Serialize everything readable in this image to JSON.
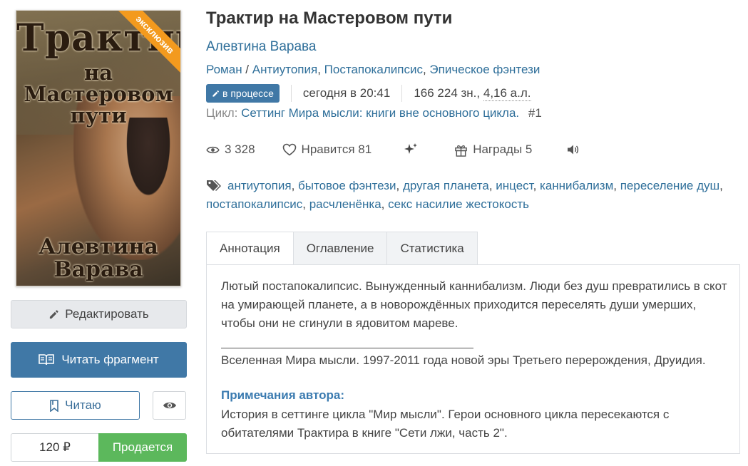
{
  "cover": {
    "title_line1": "Трактир",
    "title_line2": "на Мастеровом пути",
    "author_text": "Алевтина Варава",
    "ribbon": "эксклюзив"
  },
  "actions": {
    "edit_label": "Редактировать",
    "read_fragment_label": "Читать фрагмент",
    "reading_label": "Читаю",
    "price": "120 ₽",
    "sale_label": "Продается"
  },
  "book": {
    "title": "Трактир на Мастеровом пути",
    "author": "Алевтина Варава",
    "genres": [
      "Роман",
      "Антиутопия",
      "Постапокалипсис",
      "Эпическое фэнтези"
    ],
    "genre_sep1": " / ",
    "genre_sep2": ", ",
    "genre_sep3": ", ",
    "status_badge": "в процессе",
    "updated": "сегодня в 20:41",
    "size_chars": "166 224 зн.,",
    "size_sheets": "4,16 а.л.",
    "cycle_label": "Цикл:",
    "cycle_name": "Сеттинг Мира мысли: книги вне основного цикла.",
    "cycle_num": "#1"
  },
  "stats": {
    "views": "3 328",
    "likes_label": "Нравится 81",
    "awards_label": "Награды 5"
  },
  "tags": [
    "антиутопия",
    "бытовое фэнтези",
    "другая планета",
    "инцест",
    "каннибализм",
    "переселение душ",
    "постапокалипсис",
    "расчленёнка",
    "секс насилие жестокость"
  ],
  "tabs": [
    "Аннотация",
    "Оглавление",
    "Статистика"
  ],
  "annotation": {
    "text": "Лютый постапокалипсис. Вынужденный каннибализм. Люди без душ превратились в скот на умирающей планете, а в новорождённых приходится переселять души умерших, чтобы они не сгинули в ядовитом мареве.",
    "universe": "Вселенная Мира мысли. 1997-2011 года новой эры Третьего перерождения, Друидия.",
    "notes_heading": "Примечания автора:",
    "notes": "История в сеттинге цикла \"Мир мысли\". Герои основного цикла пересекаются с обитателями Трактира в книге \"Сети лжи, часть 2\"."
  },
  "colors": {
    "accent": "#4078a6",
    "link": "#2f6f9a",
    "sale": "#5cb85c",
    "ribbon": "#f39a1e"
  }
}
